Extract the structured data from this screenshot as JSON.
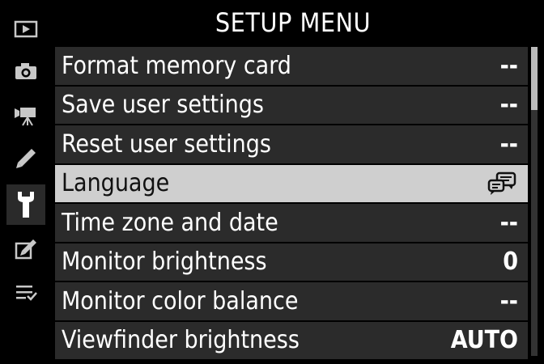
{
  "header": {
    "title": "SETUP MENU"
  },
  "sidebar": {
    "items": [
      {
        "icon": "playback-icon",
        "active": false
      },
      {
        "icon": "camera-icon",
        "active": false
      },
      {
        "icon": "movie-camera-icon",
        "active": false
      },
      {
        "icon": "pencil-icon",
        "active": false
      },
      {
        "icon": "wrench-icon",
        "active": true
      },
      {
        "icon": "retouch-icon",
        "active": false
      },
      {
        "icon": "my-menu-icon",
        "active": false
      }
    ]
  },
  "menu": {
    "items": [
      {
        "label": "Format memory card",
        "value": "--"
      },
      {
        "label": "Save user settings",
        "value": "--"
      },
      {
        "label": "Reset user settings",
        "value": "--"
      },
      {
        "label": "Language",
        "value": "",
        "icon": "language-icon",
        "selected": true
      },
      {
        "label": "Time zone and date",
        "value": "--"
      },
      {
        "label": "Monitor brightness",
        "value": "0"
      },
      {
        "label": "Monitor color balance",
        "value": "--"
      },
      {
        "label": "Viewfinder brightness",
        "value": "AUTO"
      }
    ]
  },
  "colors": {
    "background": "#000000",
    "row": "#2b2b2b",
    "selected_row": "#cfcfcf",
    "icon": "#c8c8c8"
  }
}
